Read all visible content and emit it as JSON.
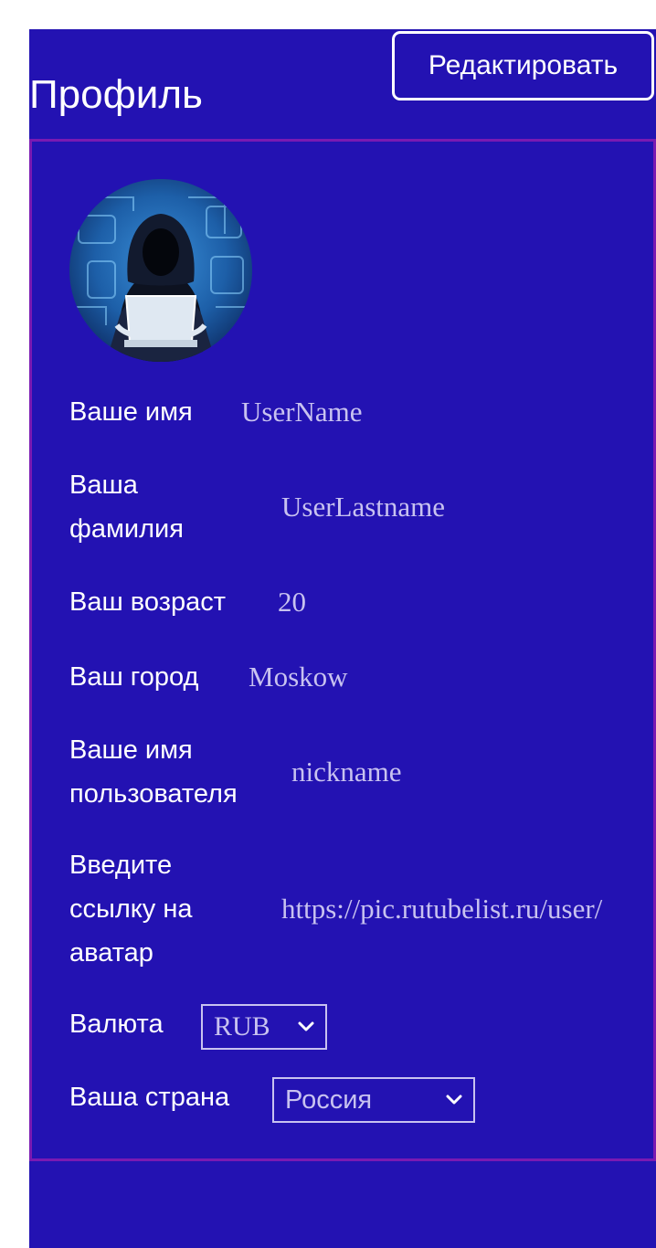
{
  "header": {
    "title": "Профиль",
    "edit_label": "Редактировать"
  },
  "profile": {
    "avatar_icon": "hooded-hacker-avatar",
    "fields": [
      {
        "label": "Ваше имя",
        "value": "UserName"
      },
      {
        "label": "Ваша фамилия",
        "value": "UserLastname"
      },
      {
        "label": "Ваш возраст",
        "value": "20"
      },
      {
        "label": "Ваш город",
        "value": "Moskow"
      },
      {
        "label": "Ваше имя пользователя",
        "value": "nickname"
      },
      {
        "label": "Введите ссылку на аватар",
        "value": "https://pic.rutubelist.ru/user/"
      }
    ],
    "currency": {
      "label": "Валюта",
      "selected": "RUB"
    },
    "country": {
      "label": "Ваша страна",
      "selected": "Россия"
    }
  },
  "colors": {
    "background": "#2312b2",
    "card_border": "#7a1ab2",
    "value_text": "#c8c2f0"
  }
}
